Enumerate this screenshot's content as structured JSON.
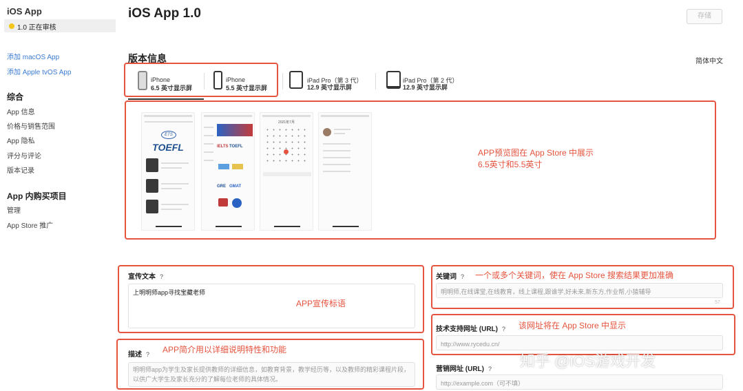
{
  "sidebar": {
    "app_name": "iOS App",
    "version_status": "1.0 正在审核",
    "links": [
      "添加 macOS App",
      "添加 Apple tvOS App"
    ],
    "sections": [
      {
        "title": "综合",
        "items": [
          "App 信息",
          "价格与销售范围",
          "App 隐私",
          "评分与评论",
          "版本记录"
        ]
      },
      {
        "title": "App 内购买项目",
        "items": [
          "管理",
          "App Store 推广"
        ]
      }
    ]
  },
  "header": {
    "title": "iOS App 1.0",
    "save_label": "存储"
  },
  "version_info": {
    "title": "版本信息",
    "language": "简体中文",
    "devices": [
      {
        "name": "iPhone",
        "size": "6.5 英寸显示屏",
        "icon": "iphone-home-button-icon"
      },
      {
        "name": "iPhone",
        "size": "5.5 英寸显示屏",
        "icon": "iphone-notch-icon"
      },
      {
        "name": "iPad Pro（第 3 代）",
        "size": "12.9 英寸显示屏",
        "icon": "ipad-pro-3-icon"
      },
      {
        "name": "iPad Pro（第 2 代）",
        "size": "12.9 英寸显示屏",
        "icon": "ipad-pro-2-icon"
      }
    ],
    "screenshot_texts": {
      "toefl": "TOEFL",
      "ets": "ETS",
      "ielts": "IELTS",
      "toefl_small": "TOEFL",
      "gre": "GRE",
      "gmat": "GMAT",
      "calendar_title": "2021年7月"
    }
  },
  "annotations": {
    "preview_note_line1": "APP预览图在 App Store 中展示",
    "preview_note_line2": "6.5英寸和5.5英寸",
    "promo_note": "APP宣传标语",
    "description_note": "APP简介用以详细说明特性和功能",
    "keywords_note": "一个或多个关键词，使在 App Store 搜索结果更加准确",
    "support_note": "该网址将在 App Store 中显示"
  },
  "form": {
    "promo": {
      "label": "宣传文本",
      "help": "?",
      "value": "上明明师app寻找宝藏老师"
    },
    "description": {
      "label": "描述",
      "help": "?",
      "placeholder": "明明师app为学生及家长提供教师的详细信息，如教育背景，教学经历等，以及教师的精彩课程片段，以供广大学生及家长充分的了解每位老师的具体情况。"
    },
    "keywords": {
      "label": "关键词",
      "help": "?",
      "placeholder": "明明师,在线课堂,在线教育，线上课程,跟谁学,好未来,新东方,作业帮,小猿辅导",
      "counter": "57"
    },
    "support_url": {
      "label": "技术支持网址 (URL)",
      "help": "?",
      "placeholder": "http://www.rycedu.cn/"
    },
    "marketing_url": {
      "label": "营销网址 (URL)",
      "help": "?",
      "placeholder": "http://example.com（可不填）"
    }
  },
  "watermark": "知乎 @iOS游戏开发",
  "colors": {
    "annotation_red": "#e5533e",
    "status_yellow": "#f5c518",
    "link_blue": "#3a7bd5"
  }
}
